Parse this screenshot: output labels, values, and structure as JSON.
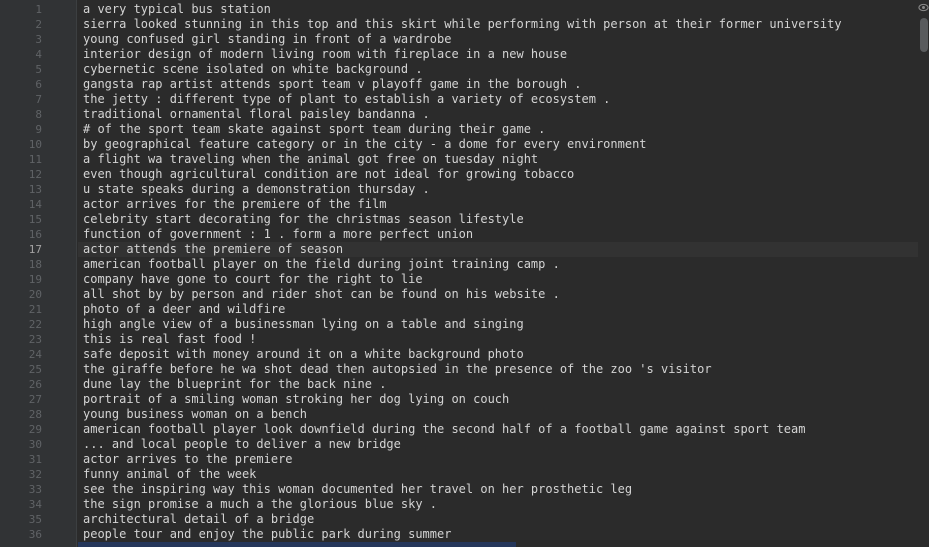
{
  "editor": {
    "current_line": 17,
    "lines": [
      {
        "num": "1",
        "text": "a very typical bus station"
      },
      {
        "num": "2",
        "text": "sierra looked stunning in this top and this skirt while performing with person at their former university"
      },
      {
        "num": "3",
        "text": "young confused girl standing in front of a wardrobe"
      },
      {
        "num": "4",
        "text": "interior design of modern living room with fireplace in a new house"
      },
      {
        "num": "5",
        "text": "cybernetic scene isolated on white background ."
      },
      {
        "num": "6",
        "text": "gangsta rap artist attends sport team v playoff game in the borough ."
      },
      {
        "num": "7",
        "text": "the jetty : different type of plant to establish a variety of ecosystem ."
      },
      {
        "num": "8",
        "text": "traditional ornamental floral paisley bandanna ."
      },
      {
        "num": "9",
        "text": "# of the sport team skate against sport team during their game ."
      },
      {
        "num": "10",
        "text": "by geographical feature category or in the city - a dome for every environment"
      },
      {
        "num": "11",
        "text": "a flight wa traveling when the animal got free on tuesday night"
      },
      {
        "num": "12",
        "text": "even though agricultural condition are not ideal for growing tobacco"
      },
      {
        "num": "13",
        "text": "u state speaks during a demonstration thursday ."
      },
      {
        "num": "14",
        "text": "actor arrives for the premiere of the film"
      },
      {
        "num": "15",
        "text": "celebrity start decorating for the christmas season lifestyle"
      },
      {
        "num": "16",
        "text": "function of government : 1 . form a more perfect union"
      },
      {
        "num": "17",
        "text": "actor attends the premiere of season"
      },
      {
        "num": "18",
        "text": "american football player on the field during joint training camp ."
      },
      {
        "num": "19",
        "text": "company have gone to court for the right to lie"
      },
      {
        "num": "20",
        "text": "all shot by by person and rider shot can be found on his website ."
      },
      {
        "num": "21",
        "text": "photo of a deer and wildfire"
      },
      {
        "num": "22",
        "text": "high angle view of a businessman lying on a table and singing"
      },
      {
        "num": "23",
        "text": "this is real fast food !"
      },
      {
        "num": "24",
        "text": "safe deposit with money around it on a white background photo"
      },
      {
        "num": "25",
        "text": "the giraffe before he wa shot dead then autopsied in the presence of the zoo 's visitor"
      },
      {
        "num": "26",
        "text": "dune lay the blueprint for the back nine ."
      },
      {
        "num": "27",
        "text": "portrait of a smiling woman stroking her dog lying on couch"
      },
      {
        "num": "28",
        "text": "young business woman on a bench"
      },
      {
        "num": "29",
        "text": "american football player look downfield during the second half of a football game against sport team"
      },
      {
        "num": "30",
        "text": "... and local people to deliver a new bridge"
      },
      {
        "num": "31",
        "text": "actor arrives to the premiere"
      },
      {
        "num": "32",
        "text": "funny animal of the week"
      },
      {
        "num": "33",
        "text": "see the inspiring way this woman documented her travel on her prosthetic leg"
      },
      {
        "num": "34",
        "text": "the sign promise a much a the glorious blue sky ."
      },
      {
        "num": "35",
        "text": "architectural detail of a bridge"
      },
      {
        "num": "36",
        "text": "people tour and enjoy the public park during summer"
      }
    ]
  },
  "colors": {
    "background": "#2b2b2b",
    "gutter": "#313335",
    "text": "#d4d4d4",
    "line_number": "#606366",
    "current_line": "#323232"
  },
  "icons": {
    "top_right": "eye-icon"
  }
}
